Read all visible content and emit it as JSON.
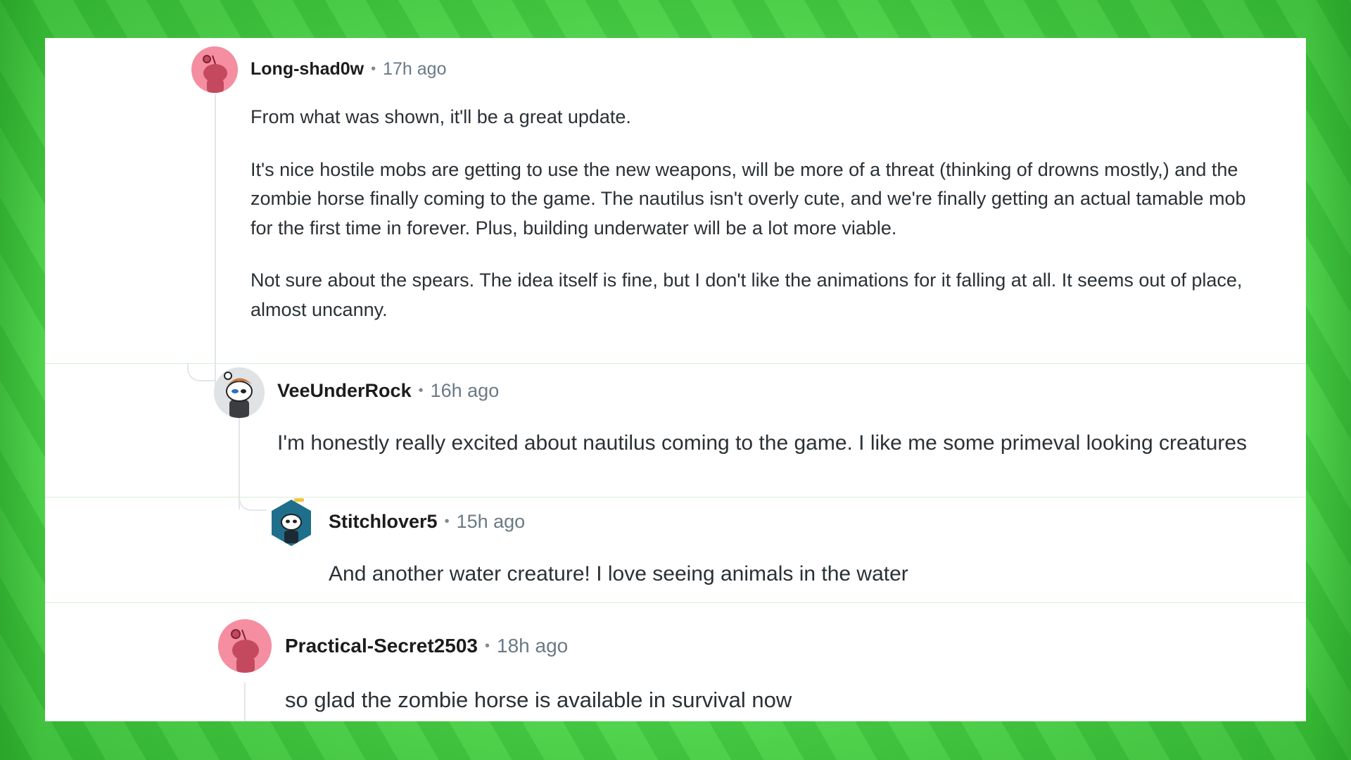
{
  "comments": [
    {
      "username": "Long-shad0w",
      "time": "17h ago",
      "paragraphs": [
        "From what was shown, it'll be a great update.",
        "It's nice hostile mobs are getting to use the new weapons, will be more of a threat (thinking of drowns mostly,) and the zombie horse finally coming to the game. The nautilus isn't overly cute, and we're finally getting an actual tamable mob for the first time in forever. Plus, building underwater will be a lot more viable.",
        "Not sure about the spears. The idea itself is fine, but I don't like the animations for it falling at all. It seems out of place, almost uncanny."
      ],
      "avatar_icon": "snoo-default-avatar",
      "avatar_color": "#f58ea0"
    },
    {
      "username": "VeeUnderRock",
      "time": "16h ago",
      "paragraphs": [
        "I'm honestly really excited about nautilus coming to the game. I like me some primeval looking creatures"
      ],
      "avatar_icon": "snoo-custom-avatar",
      "avatar_color": "#dfe3e6"
    },
    {
      "username": "Stitchlover5",
      "time": "15h ago",
      "paragraphs": [
        "And another water creature! I love seeing animals in the water"
      ],
      "avatar_icon": "snoo-hexagon-nft-avatar",
      "avatar_color": "#1f6f8c"
    },
    {
      "username": "Practical-Secret2503",
      "time": "18h ago",
      "paragraphs": [
        "so glad the zombie horse is available in survival now"
      ],
      "avatar_icon": "snoo-default-avatar",
      "avatar_color": "#f58ea0"
    }
  ],
  "separator": "•",
  "colors": {
    "background": "#5ee35a",
    "card": "#ffffff",
    "username": "#1c1c1c",
    "timestamp": "#6a7a85",
    "body": "#2a3136",
    "thread_line": "#e3e6e8"
  }
}
